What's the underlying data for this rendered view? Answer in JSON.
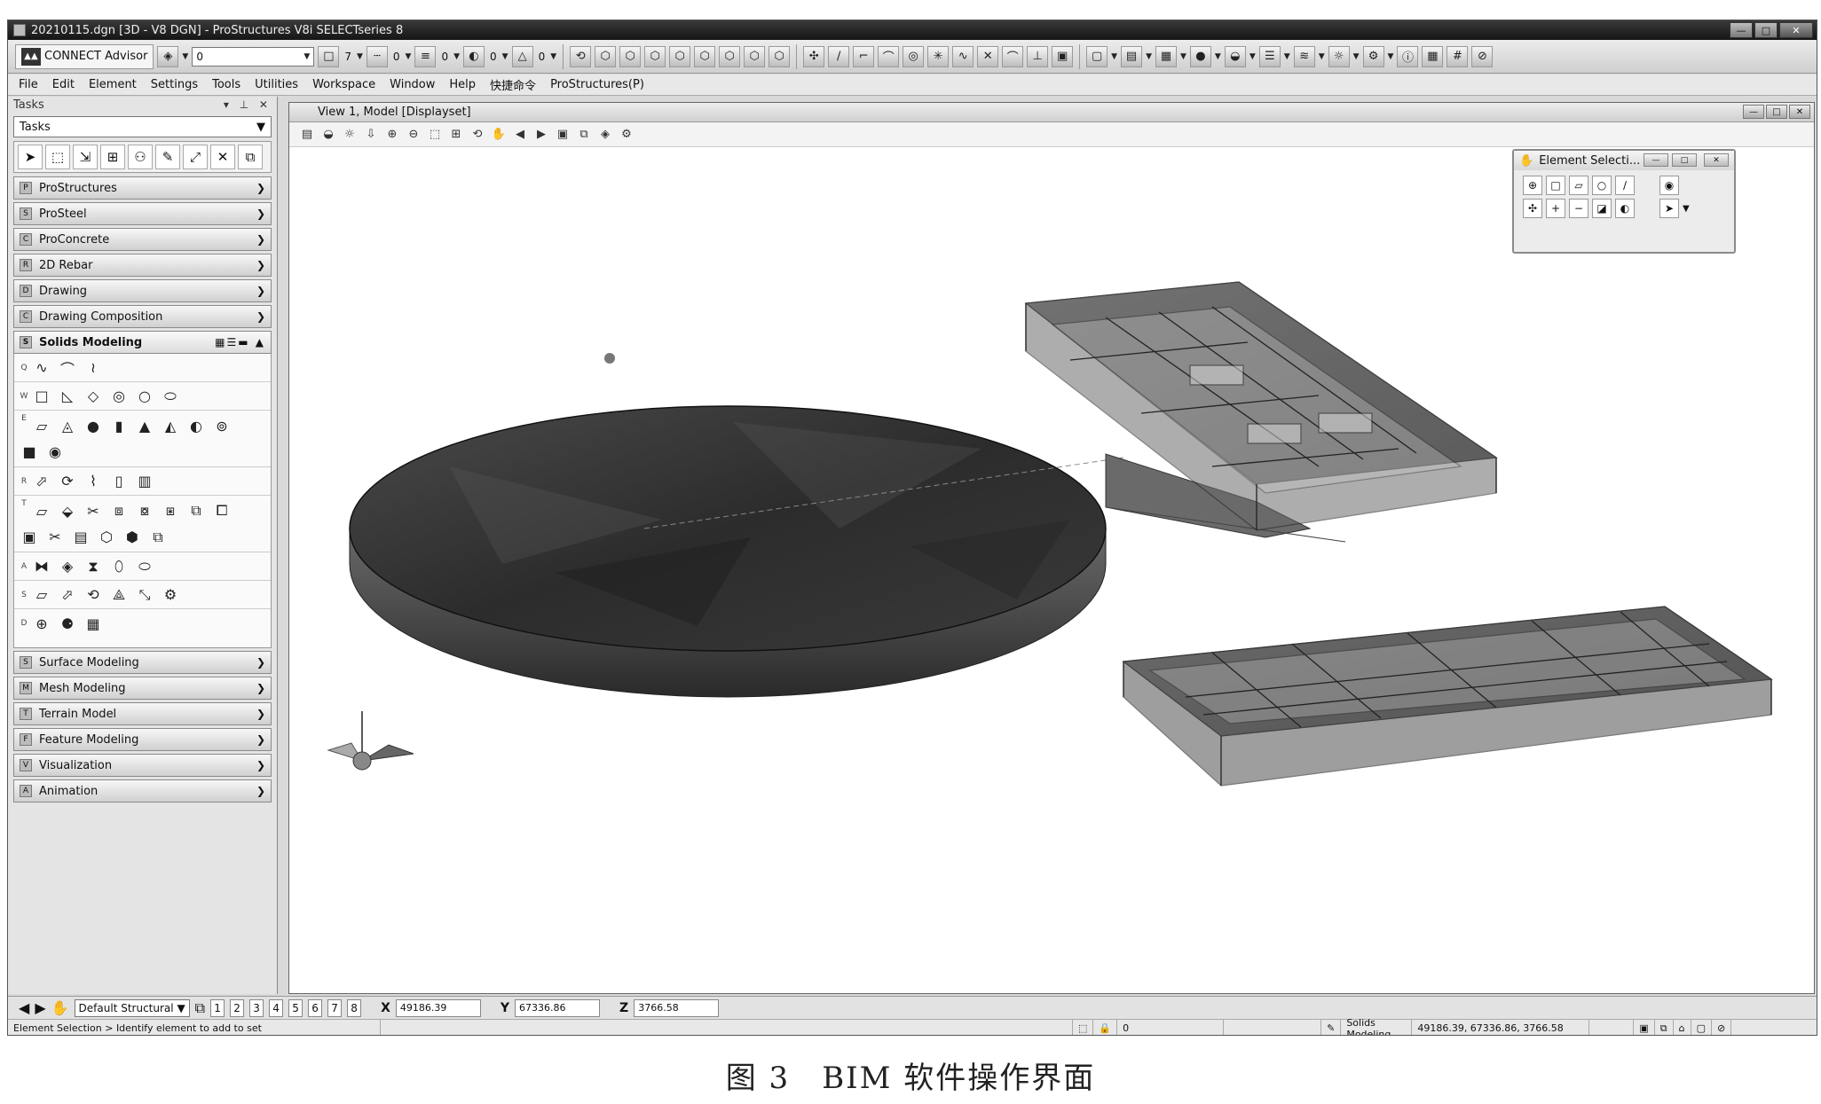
{
  "window": {
    "title": "20210115.dgn [3D - V8 DGN] - ProStructures V8i SELECTseries 8",
    "btn_min": "—",
    "btn_max": "□",
    "btn_close": "✕"
  },
  "toolbar": {
    "advisor_label": "CONNECT Advisor",
    "level_value": "0",
    "color_value": "7",
    "style_value": "0",
    "weight_value": "0",
    "transparency_value": "0",
    "priority_value": "0"
  },
  "menu": [
    "File",
    "Edit",
    "Element",
    "Settings",
    "Tools",
    "Utilities",
    "Workspace",
    "Window",
    "Help",
    "快捷命令",
    "ProStructures(P)"
  ],
  "tasks": {
    "header": "Tasks",
    "selector": "Tasks",
    "sections_top": [
      "ProStructures",
      "ProSteel",
      "ProConcrete",
      "2D Rebar",
      "Drawing",
      "Drawing Composition"
    ],
    "open_section": "Solids Modeling",
    "sections_bottom": [
      "Surface Modeling",
      "Mesh Modeling",
      "Terrain Model",
      "Feature Modeling",
      "Visualization",
      "Animation"
    ],
    "row_letters": [
      "Q",
      "W",
      "E",
      "R",
      "T",
      "A",
      "S",
      "D"
    ]
  },
  "view": {
    "title": "View 1, Model [Displayset]"
  },
  "element_selection": {
    "title": "Element Selecti..."
  },
  "coords": {
    "view_group": "Default Structural",
    "view_numbers": [
      "1",
      "2",
      "3",
      "4",
      "5",
      "6",
      "7",
      "8"
    ],
    "x_label": "X",
    "x_value": "49186.39",
    "y_label": "Y",
    "y_value": "67336.86",
    "z_label": "Z",
    "z_value": "3766.58"
  },
  "status": {
    "prompt": "Element Selection > Identify element to add to set",
    "level_count": "0",
    "active_task": "Solids Modeling",
    "coord_readout": "49186.39, 67336.86, 3766.58"
  },
  "caption": "图 3　BIM 软件操作界面"
}
